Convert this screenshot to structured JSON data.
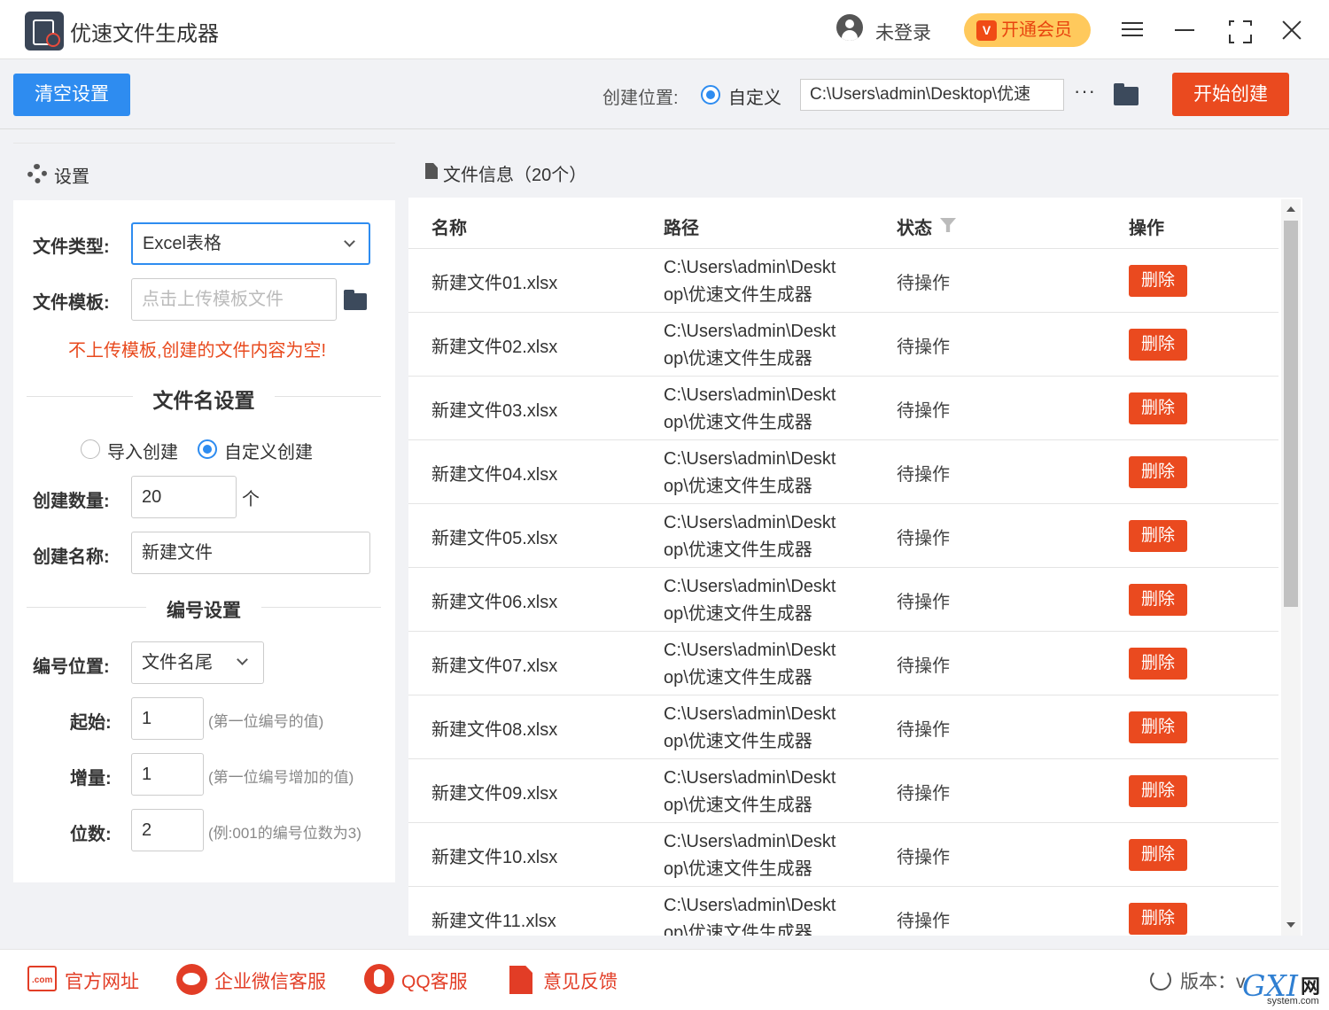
{
  "titlebar": {
    "title": "优速文件生成器",
    "login_text": "未登录",
    "vip_label": "开通会员",
    "vip_badge": "V"
  },
  "toolbar": {
    "clear_label": "清空设置",
    "location_label": "创建位置:",
    "location_option": "自定义",
    "path_value": "C:\\Users\\admin\\Desktop\\优速",
    "more_label": "···",
    "start_label": "开始创建"
  },
  "settings": {
    "header": "设置",
    "file_type_label": "文件类型:",
    "file_type_value": "Excel表格",
    "template_label": "文件模板:",
    "template_placeholder": "点击上传模板文件",
    "warning": "不上传模板,创建的文件内容为空!",
    "name_section_title": "文件名设置",
    "mode_import": "导入创建",
    "mode_custom": "自定义创建",
    "count_label": "创建数量:",
    "count_value": "20",
    "count_unit": "个",
    "name_label": "创建名称:",
    "name_value": "新建文件",
    "number_section_title": "编号设置",
    "pos_label": "编号位置:",
    "pos_value": "文件名尾",
    "start_label": "起始:",
    "start_value": "1",
    "start_hint": "(第一位编号的值)",
    "step_label": "增量:",
    "step_value": "1",
    "step_hint": "(第一位编号增加的值)",
    "digits_label": "位数:",
    "digits_value": "2",
    "digits_hint": "(例:001的编号位数为3)"
  },
  "files": {
    "header": "文件信息（20个）",
    "columns": {
      "name": "名称",
      "path": "路径",
      "status": "状态",
      "action": "操作"
    },
    "rows": [
      {
        "name": "新建文件01.xlsx",
        "path1": "C:\\Users\\admin\\Deskt",
        "path2": "op\\优速文件生成器",
        "status": "待操作",
        "action": "删除"
      },
      {
        "name": "新建文件02.xlsx",
        "path1": "C:\\Users\\admin\\Deskt",
        "path2": "op\\优速文件生成器",
        "status": "待操作",
        "action": "删除"
      },
      {
        "name": "新建文件03.xlsx",
        "path1": "C:\\Users\\admin\\Deskt",
        "path2": "op\\优速文件生成器",
        "status": "待操作",
        "action": "删除"
      },
      {
        "name": "新建文件04.xlsx",
        "path1": "C:\\Users\\admin\\Deskt",
        "path2": "op\\优速文件生成器",
        "status": "待操作",
        "action": "删除"
      },
      {
        "name": "新建文件05.xlsx",
        "path1": "C:\\Users\\admin\\Deskt",
        "path2": "op\\优速文件生成器",
        "status": "待操作",
        "action": "删除"
      },
      {
        "name": "新建文件06.xlsx",
        "path1": "C:\\Users\\admin\\Deskt",
        "path2": "op\\优速文件生成器",
        "status": "待操作",
        "action": "删除"
      },
      {
        "name": "新建文件07.xlsx",
        "path1": "C:\\Users\\admin\\Deskt",
        "path2": "op\\优速文件生成器",
        "status": "待操作",
        "action": "删除"
      },
      {
        "name": "新建文件08.xlsx",
        "path1": "C:\\Users\\admin\\Deskt",
        "path2": "op\\优速文件生成器",
        "status": "待操作",
        "action": "删除"
      },
      {
        "name": "新建文件09.xlsx",
        "path1": "C:\\Users\\admin\\Deskt",
        "path2": "op\\优速文件生成器",
        "status": "待操作",
        "action": "删除"
      },
      {
        "name": "新建文件10.xlsx",
        "path1": "C:\\Users\\admin\\Deskt",
        "path2": "op\\优速文件生成器",
        "status": "待操作",
        "action": "删除"
      },
      {
        "name": "新建文件11.xlsx",
        "path1": "C:\\Users\\admin\\Deskt",
        "path2": "op\\优速文件生成器",
        "status": "待操作",
        "action": "删除"
      }
    ]
  },
  "footer": {
    "site_label": "官方网址",
    "site_icon_text": ".com",
    "wechat_label": "企业微信客服",
    "qq_label": "QQ客服",
    "feedback_label": "意见反馈",
    "version_label": "版本：v"
  },
  "watermark": {
    "g": "GXI",
    "net": "网",
    "domain": "system.com"
  },
  "colors": {
    "primary": "#2e8cf0",
    "danger": "#ea4a1f",
    "vip": "#ffc95c"
  }
}
